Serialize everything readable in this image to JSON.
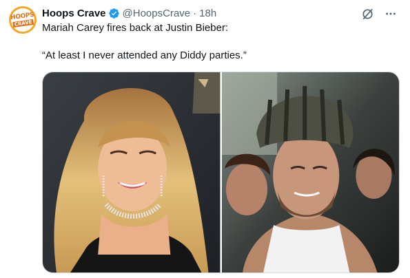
{
  "tweet": {
    "avatar": {
      "line1": "HOOPS",
      "line2": "CRAVE"
    },
    "author_name": "Hoops Crave",
    "verified_icon": "verified-badge-icon",
    "handle": "@HoopsCrave",
    "separator": "·",
    "timestamp": "18h",
    "text_line1": "Mariah Carey fires back at Justin Bieber:",
    "text_line2": "“At least I never attended any Diddy parties.”",
    "top_icons": [
      "grok-icon",
      "more-icon"
    ]
  },
  "colors": {
    "verified": "#1d9bf0",
    "text": "#0f1419",
    "secondary": "#536471",
    "avatar_orange": "#e0711b"
  },
  "media": {
    "photos": [
      "mariah-carey-photo",
      "justin-bieber-photo"
    ]
  }
}
